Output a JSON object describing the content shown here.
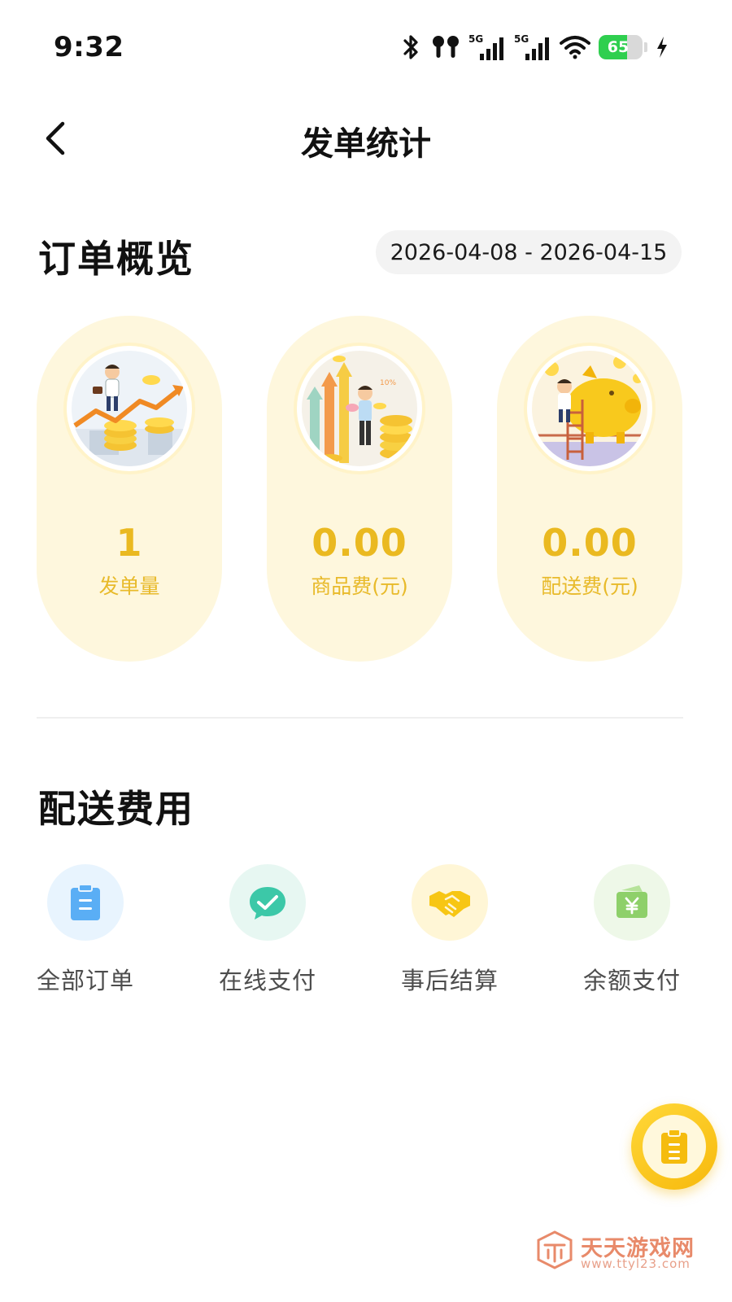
{
  "status_bar": {
    "time": "9:32",
    "battery_level": "65",
    "signal_1_label": "5G",
    "signal_2_label": "5G",
    "icons": [
      "bluetooth-icon",
      "earbuds-icon",
      "signal-5g-icon",
      "signal-5g-icon",
      "wifi-icon",
      "battery-icon",
      "charging-icon"
    ]
  },
  "nav": {
    "title": "发单统计",
    "back_icon": "chevron-left-icon"
  },
  "overview": {
    "title": "订单概览",
    "date_range": "2026-04-08 - 2026-04-15",
    "stats": [
      {
        "value": "1",
        "label": "发单量",
        "illustration": "businessman-growth-illustration"
      },
      {
        "value": "0.00",
        "label": "商品费(元)",
        "illustration": "businessman-coins-illustration"
      },
      {
        "value": "0.00",
        "label": "配送费(元)",
        "illustration": "piggy-bank-illustration"
      }
    ]
  },
  "fees": {
    "title": "配送费用",
    "items": [
      {
        "label": "全部订单",
        "icon": "clipboard-icon",
        "color": "#5aaef5",
        "bg": "#e8f4fe"
      },
      {
        "label": "在线支付",
        "icon": "chat-check-icon",
        "color": "#3cc8a8",
        "bg": "#e7f7f2"
      },
      {
        "label": "事后结算",
        "icon": "handshake-icon",
        "color": "#f7c614",
        "bg": "#fff6d6"
      },
      {
        "label": "余额支付",
        "icon": "wallet-yen-icon",
        "color": "#8ed06a",
        "bg": "#eef8e8"
      }
    ]
  },
  "fab": {
    "icon": "clipboard-icon"
  },
  "watermark": {
    "name": "天天游戏网",
    "url": "www.ttyl23.com"
  },
  "colors": {
    "accent": "#eab920",
    "card_bg": "#fef7dd",
    "fab": "#f7c10e"
  }
}
